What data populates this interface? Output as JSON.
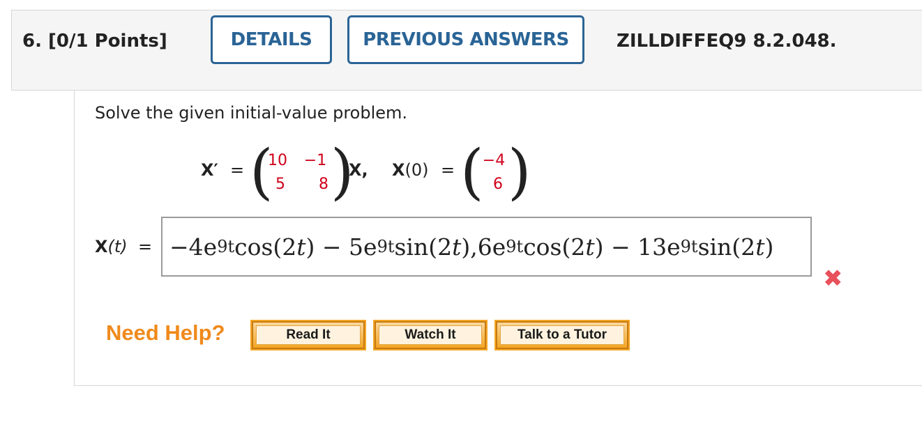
{
  "header": {
    "question_number": "6.",
    "points": "[0/1 Points]",
    "details_label": "DETAILS",
    "previous_answers_label": "PREVIOUS ANSWERS",
    "problem_code": "ZILLDIFFEQ9 8.2.048."
  },
  "problem": {
    "prompt": "Solve the given initial-value problem.",
    "lhs": "X′",
    "equals": "=",
    "matrix": {
      "a11": "10",
      "a12": "−1",
      "a21": "5",
      "a22": "8"
    },
    "x_label": "X,",
    "ic_label": "X",
    "ic_arg": "(0)",
    "ic_vector": {
      "v1": "−4",
      "v2": "6"
    }
  },
  "answer": {
    "label": "X",
    "label_arg": "(t)",
    "equals": "=",
    "value_parts": {
      "p1": "−4e",
      "e1": "9t",
      "p2": "cos(2",
      "v1": "t",
      "p3": ") − 5e",
      "e2": "9t",
      "p4": "sin(2",
      "v2": "t",
      "p5": "),6e",
      "e3": "9t",
      "p6": "cos(2",
      "v3": "t",
      "p7": ") − 13e",
      "e4": "9t",
      "p8": "sin(2",
      "v4": "t",
      "p9": ")"
    },
    "status": "incorrect",
    "status_color": "#e8505b"
  },
  "help": {
    "need_help_label": "Need Help?",
    "read_it_label": "Read It",
    "watch_it_label": "Watch It",
    "talk_tutor_label": "Talk to a Tutor"
  },
  "colors": {
    "accent": "#2a6496",
    "matrix_entries": "#d0021b",
    "need_help": "#f08a1c",
    "help_button": "#f5a623"
  }
}
